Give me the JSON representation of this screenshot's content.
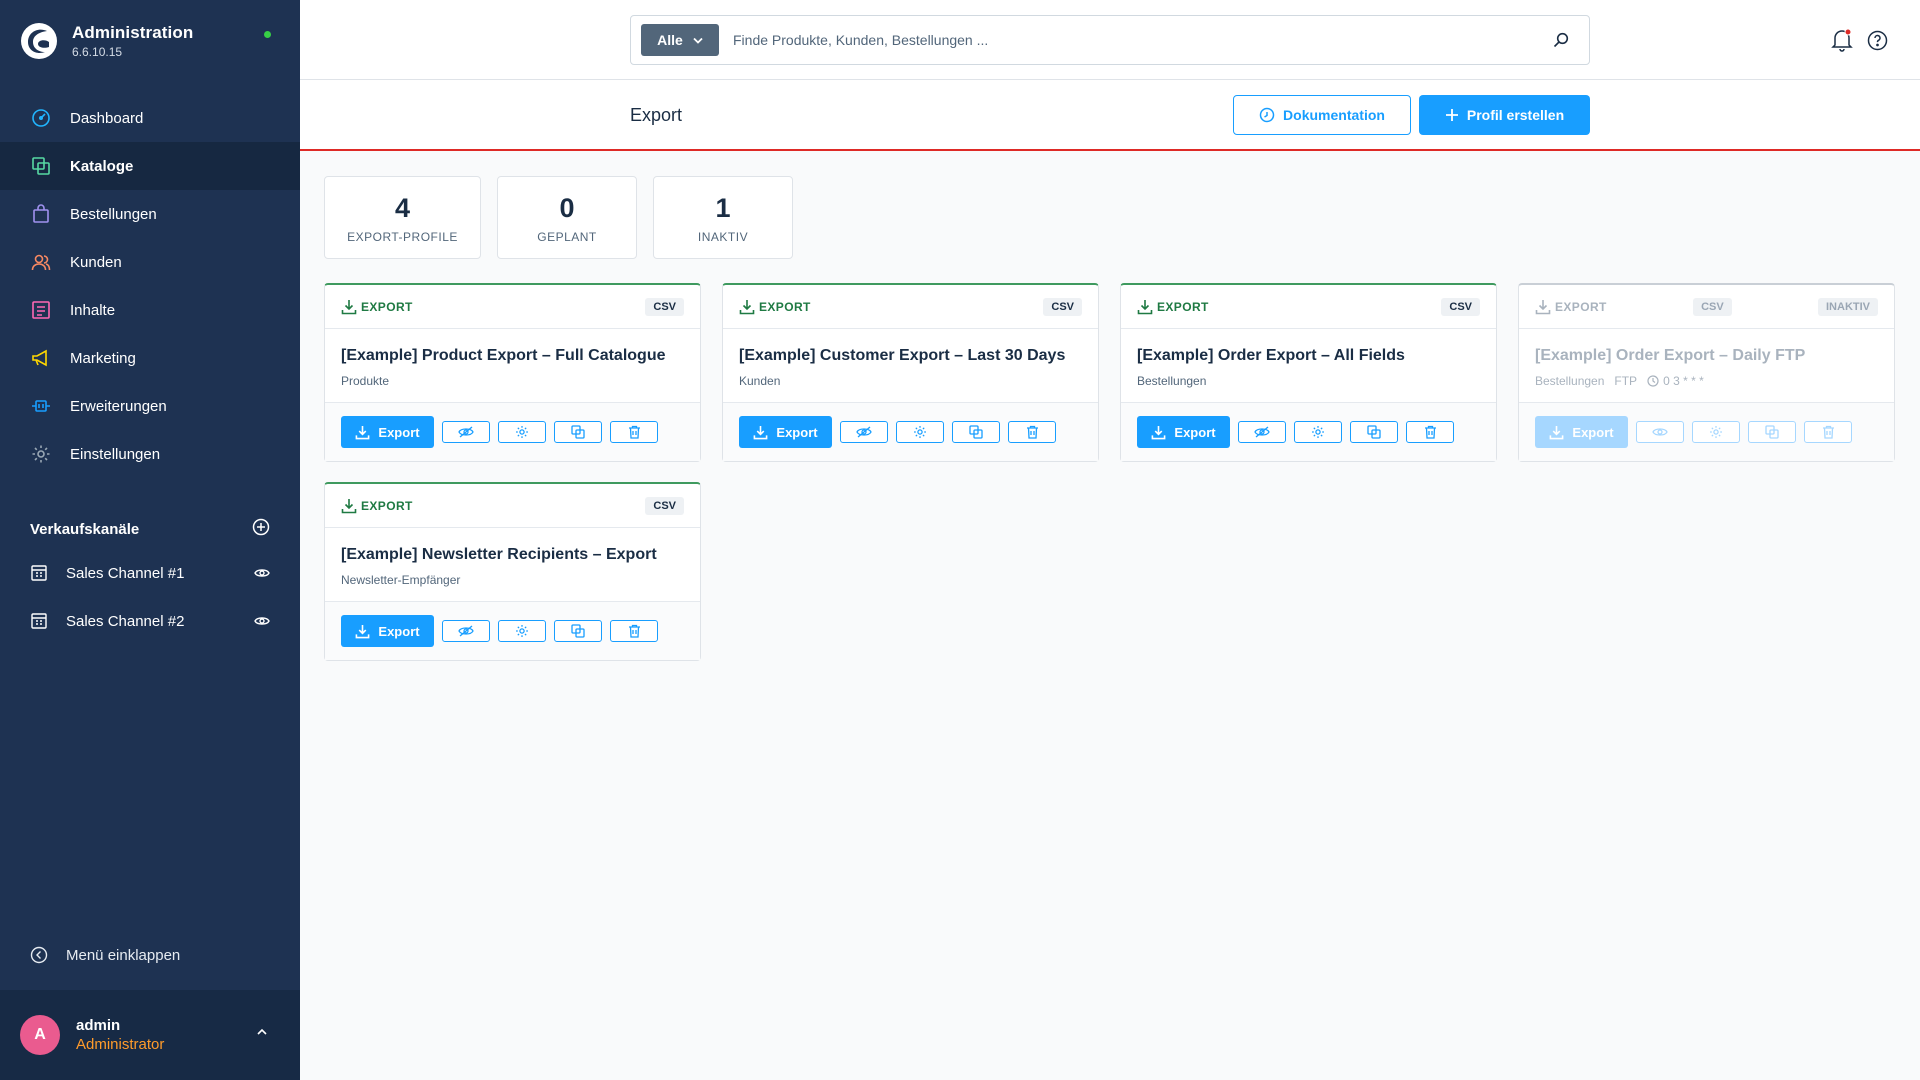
{
  "app": {
    "title": "Administration",
    "version": "6.6.10.15",
    "status_color": "#37d046"
  },
  "sidebar": {
    "items": [
      {
        "label": "Dashboard",
        "icon": "gauge-icon",
        "color": "#21b5ff"
      },
      {
        "label": "Kataloge",
        "icon": "catalog-icon",
        "color": "#57d9a3",
        "active": true
      },
      {
        "label": "Bestellungen",
        "icon": "shopping-bag-icon",
        "color": "#a092f0"
      },
      {
        "label": "Kunden",
        "icon": "users-icon",
        "color": "#f88962"
      },
      {
        "label": "Inhalte",
        "icon": "content-icon",
        "color": "#ff68b4"
      },
      {
        "label": "Marketing",
        "icon": "megaphone-icon",
        "color": "#ffd700"
      },
      {
        "label": "Erweiterungen",
        "icon": "plug-icon",
        "color": "#189eff"
      },
      {
        "label": "Einstellungen",
        "icon": "gear-icon",
        "color": "#9aa8b5"
      }
    ],
    "channels_heading": "Verkaufskanäle",
    "channels": [
      {
        "label": "Sales Channel #1"
      },
      {
        "label": "Sales Channel #2"
      }
    ],
    "collapse_label": "Menü einklappen",
    "user": {
      "initial": "A",
      "name": "admin",
      "role": "Administrator"
    }
  },
  "search": {
    "type_label": "Alle",
    "placeholder": "Finde Produkte, Kunden, Bestellungen ..."
  },
  "header": {
    "title": "Export",
    "doc_button": "Dokumentation",
    "create_button": "Profil erstellen"
  },
  "stats": [
    {
      "value": "4",
      "label": "EXPORT-PROFILE"
    },
    {
      "value": "0",
      "label": "GEPLANT"
    },
    {
      "value": "1",
      "label": "INAKTIV"
    }
  ],
  "cards": [
    {
      "type": "EXPORT",
      "format": "CSV",
      "title": "[Example] Product Export – Full Catalogue",
      "subtitle": "Produkte",
      "export_label": "Export"
    },
    {
      "type": "EXPORT",
      "format": "CSV",
      "title": "[Example] Customer Export – Last 30 Days",
      "subtitle": "Kunden",
      "export_label": "Export"
    },
    {
      "type": "EXPORT",
      "format": "CSV",
      "title": "[Example] Order Export – All Fields",
      "subtitle": "Bestellungen",
      "export_label": "Export"
    },
    {
      "type": "EXPORT",
      "format": "CSV",
      "status": "INAKTIV",
      "title": "[Example] Order Export – Daily FTP",
      "subtitle": "Bestellungen",
      "transport": "FTP",
      "schedule": "0 3 * * *",
      "export_label": "Export"
    },
    {
      "type": "EXPORT",
      "format": "CSV",
      "title": "[Example] Newsletter Recipients – Export",
      "subtitle": "Newsletter-Empfänger",
      "export_label": "Export"
    }
  ]
}
